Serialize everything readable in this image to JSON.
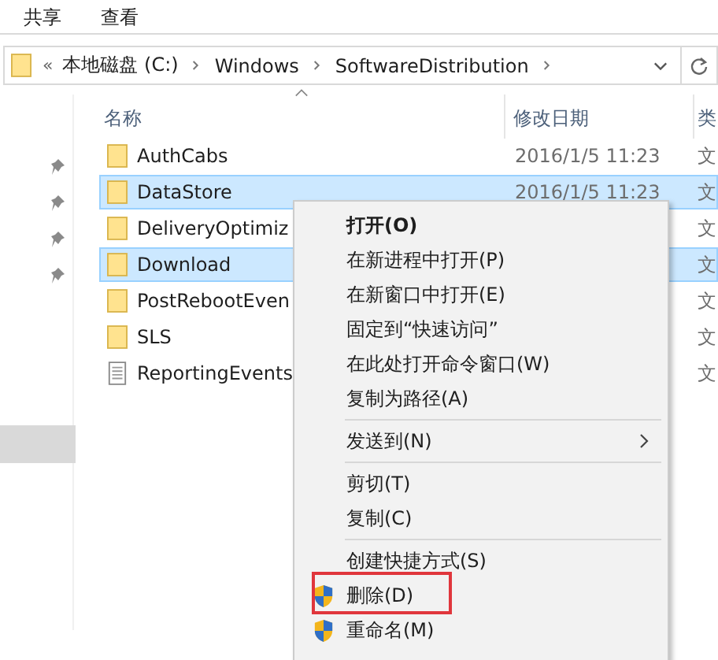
{
  "ribbon": {
    "tabs": [
      {
        "label": "共享"
      },
      {
        "label": "查看"
      }
    ]
  },
  "address_bar": {
    "overflow": "«",
    "crumbs": [
      "本地磁盘 (C:)",
      "Windows",
      "SoftwareDistribution"
    ]
  },
  "nav_pane": {
    "items": [
      {
        "pinned": true
      },
      {
        "pinned": true
      },
      {
        "pinned": true
      },
      {
        "pinned": true
      }
    ],
    "has_selection": true
  },
  "columns": [
    {
      "label": "名称",
      "sorted": true
    },
    {
      "label": "修改日期",
      "sorted": false
    },
    {
      "label": "类",
      "sorted": false
    }
  ],
  "rows": [
    {
      "kind": "folder",
      "name": "AuthCabs",
      "date": "2016/1/5 11:23",
      "type": "文",
      "selected": false
    },
    {
      "kind": "folder",
      "name": "DataStore",
      "date": "2016/1/5 11:23",
      "type": "文",
      "selected": true
    },
    {
      "kind": "folder",
      "name": "DeliveryOptimiz",
      "type": "文",
      "selected": false
    },
    {
      "kind": "folder",
      "name": "Download",
      "type": "文",
      "selected": true
    },
    {
      "kind": "folder",
      "name": "PostRebootEven",
      "type": "文",
      "selected": false
    },
    {
      "kind": "folder",
      "name": "SLS",
      "type": "文",
      "selected": false
    },
    {
      "kind": "file",
      "name": "ReportingEvents",
      "type": "文",
      "selected": false
    }
  ],
  "menu": {
    "items": [
      {
        "kind": "item",
        "label": "打开(O)",
        "default": true,
        "submenu": false,
        "shield": false,
        "marked": false
      },
      {
        "kind": "item",
        "label": "在新进程中打开(P)",
        "default": false,
        "submenu": false,
        "shield": false,
        "marked": false
      },
      {
        "kind": "item",
        "label": "在新窗口中打开(E)",
        "default": false,
        "submenu": false,
        "shield": false,
        "marked": false
      },
      {
        "kind": "item",
        "label": "固定到“快速访问”",
        "default": false,
        "submenu": false,
        "shield": false,
        "marked": false
      },
      {
        "kind": "item",
        "label": "在此处打开命令窗口(W)",
        "default": false,
        "submenu": false,
        "shield": false,
        "marked": false
      },
      {
        "kind": "item",
        "label": "复制为路径(A)",
        "default": false,
        "submenu": false,
        "shield": false,
        "marked": false
      },
      {
        "kind": "separator"
      },
      {
        "kind": "item",
        "label": "发送到(N)",
        "default": false,
        "submenu": true,
        "shield": false,
        "marked": false
      },
      {
        "kind": "separator"
      },
      {
        "kind": "item",
        "label": "剪切(T)",
        "default": false,
        "submenu": false,
        "shield": false,
        "marked": false
      },
      {
        "kind": "item",
        "label": "复制(C)",
        "default": false,
        "submenu": false,
        "shield": false,
        "marked": false
      },
      {
        "kind": "separator"
      },
      {
        "kind": "item",
        "label": "创建快捷方式(S)",
        "default": false,
        "submenu": false,
        "shield": false,
        "marked": false
      },
      {
        "kind": "item",
        "label": "删除(D)",
        "default": false,
        "submenu": false,
        "shield": true,
        "marked": true
      },
      {
        "kind": "item",
        "label": "重命名(M)",
        "default": false,
        "submenu": false,
        "shield": true,
        "marked": false
      }
    ]
  }
}
